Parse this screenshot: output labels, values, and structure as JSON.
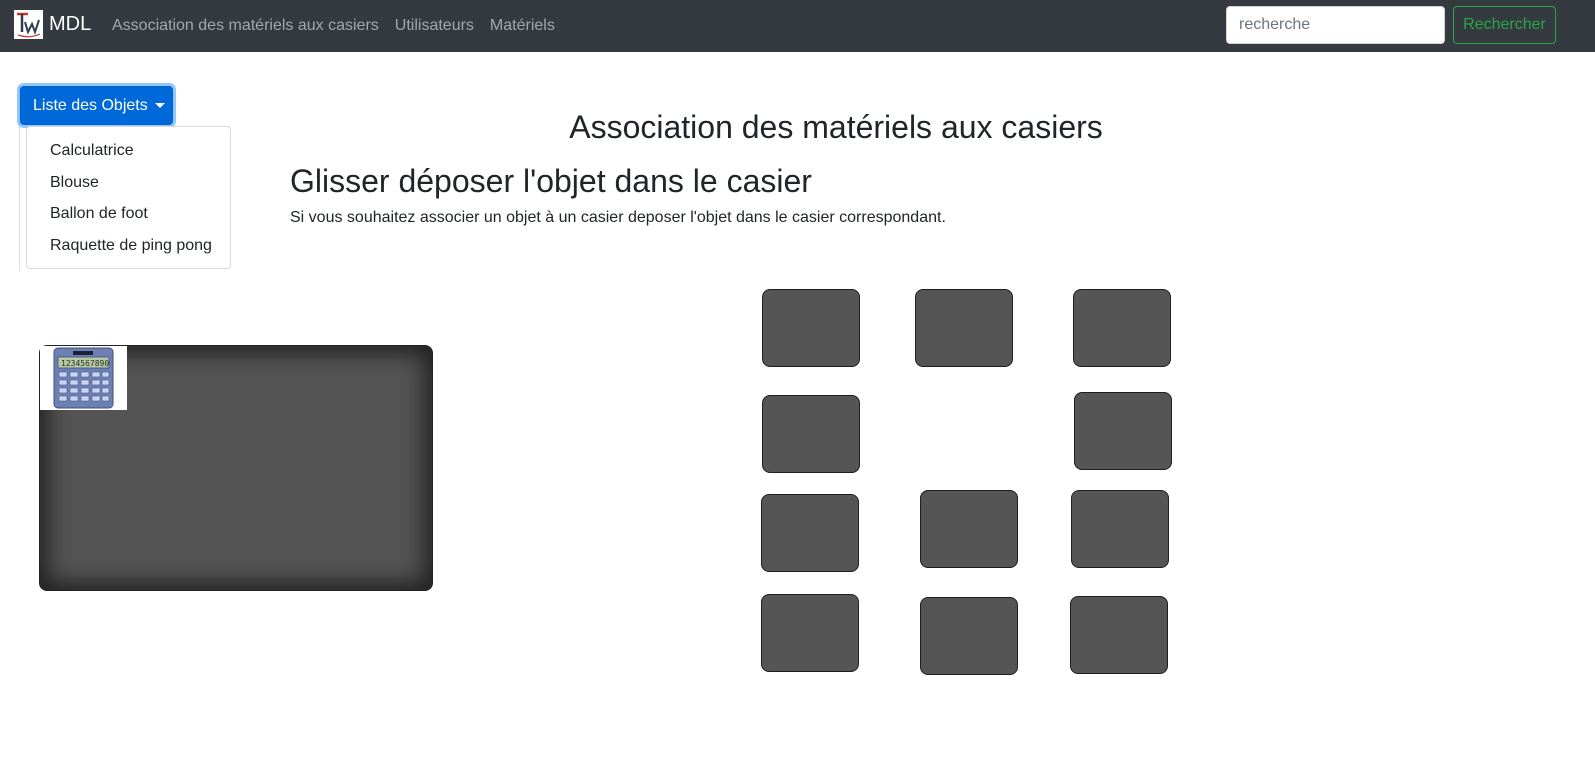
{
  "navbar": {
    "brand": "MDL",
    "links": [
      "Association des matériels aux casiers",
      "Utilisateurs",
      "Matériels"
    ],
    "search_placeholder": "recherche",
    "search_button": "Rechercher",
    "bg_color": "#343a40",
    "search_button_color": "#28a745"
  },
  "dropdown": {
    "label": "Liste des Objets",
    "items": [
      "Calculatrice",
      "Blouse",
      "Ballon de foot",
      "Raquette de ping pong"
    ],
    "button_color": "#0069d9"
  },
  "main": {
    "title": "Association des matériels aux casiers",
    "subtitle": "Glisser déposer l'objet dans le casier",
    "instructions": "Si vous souhaitez associer un objet à un casier deposer l'objet dans le casier correspondant."
  },
  "drop_zone": {
    "items": [
      "calculator-image"
    ],
    "color": "#545454"
  },
  "lockers": {
    "count": 11,
    "color": "#555555"
  }
}
